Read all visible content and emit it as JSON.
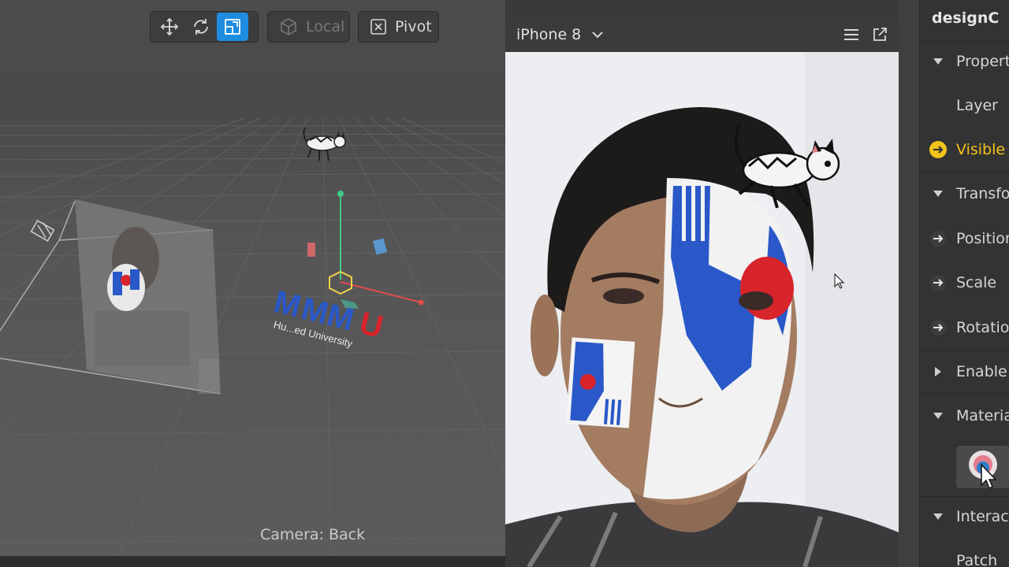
{
  "toolbar": {
    "tools": [
      {
        "name": "move-tool",
        "icon": "move-icon"
      },
      {
        "name": "rotate-tool",
        "icon": "rotate-icon"
      },
      {
        "name": "scale-tool",
        "icon": "scale-icon",
        "active": true
      }
    ],
    "local_label": "Local",
    "pivot_label": "Pivot"
  },
  "viewport": {
    "camera_label": "Camera: Back",
    "logo_text": "MMU",
    "logo_subtext": "Hu...ed University"
  },
  "simulator": {
    "device": "iPhone 8",
    "menu_icon": "menu-icon",
    "popout_icon": "popout-icon"
  },
  "inspector": {
    "title": "designC",
    "rows": [
      {
        "label": "Propert",
        "icon": "triangle-down-icon"
      },
      {
        "label": "Layer",
        "icon": ""
      },
      {
        "label": "Visible",
        "icon": "arrow-circle-yellow-icon"
      },
      {
        "label": "Transfo",
        "icon": "triangle-down-icon"
      },
      {
        "label": "Position",
        "icon": "arrow-circle-icon"
      },
      {
        "label": "Scale",
        "icon": "arrow-circle-icon"
      },
      {
        "label": "Rotation",
        "icon": "arrow-circle-icon"
      },
      {
        "label": "Enable",
        "icon": "triangle-right-icon"
      },
      {
        "label": "Materia",
        "icon": "triangle-down-icon"
      },
      {
        "label": "Interact",
        "icon": "triangle-down-icon"
      },
      {
        "label": "Patch",
        "icon": ""
      }
    ]
  },
  "colors": {
    "accent": "#1e8ce0",
    "visible_icon": "#f2c318",
    "mmu_blue": "#2a58c8",
    "mmu_red": "#d8242b"
  }
}
